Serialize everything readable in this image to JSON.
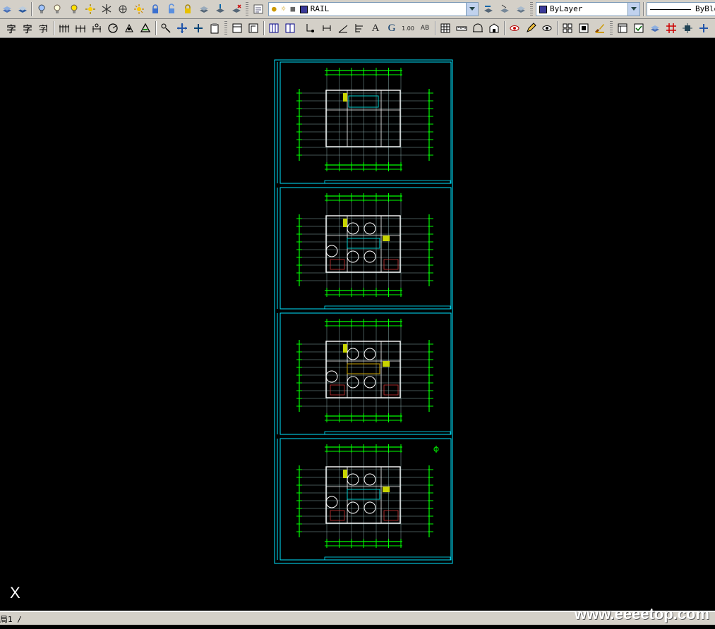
{
  "toolbar_top": {
    "layer_combo": "RAIL",
    "color_combo": "ByLayer",
    "linetype_combo": "ByBlo"
  },
  "toolbar_second": {
    "text_style_char_1": "字",
    "text_style_char_2": "字",
    "dim_value": "1.00"
  },
  "layout_tab": {
    "label": "局1 /"
  },
  "ucs_icon": "X",
  "watermark": "www.eeeetop.com",
  "colors": {
    "background": "#000000",
    "frame": "#00e5ff",
    "grid_line": "#00ff00",
    "wall": "#ffffff",
    "accent_yellow": "#c8d400"
  }
}
